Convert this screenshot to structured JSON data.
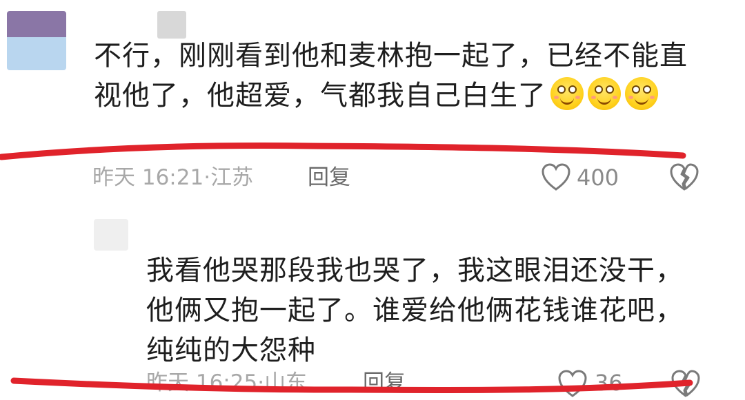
{
  "comment_1": {
    "text": "不行，刚刚看到他和麦林抱一起了，已经不能直视他了，他超爱，气都我自己白生了",
    "emoji_icons": [
      "smile-emoji-icon",
      "smile-emoji-icon",
      "smile-emoji-icon"
    ],
    "time": "昨天 16:21",
    "location": "江苏",
    "reply_label": "回复",
    "likes": "400"
  },
  "comment_2": {
    "text_line1": "我看他哭那段我也哭了，我这眼泪还没干，",
    "text_line2": "他俩又抱一起了。谁爱给他俩花钱谁花吧，",
    "text_line3": "纯纯的大怨种",
    "time": "昨天 16:25",
    "location": "山东",
    "reply_label": "回复",
    "likes": "36"
  },
  "colors": {
    "underline": "#e0232b",
    "meta_text": "#a8a8a8",
    "body_text": "#1e1e1e"
  }
}
